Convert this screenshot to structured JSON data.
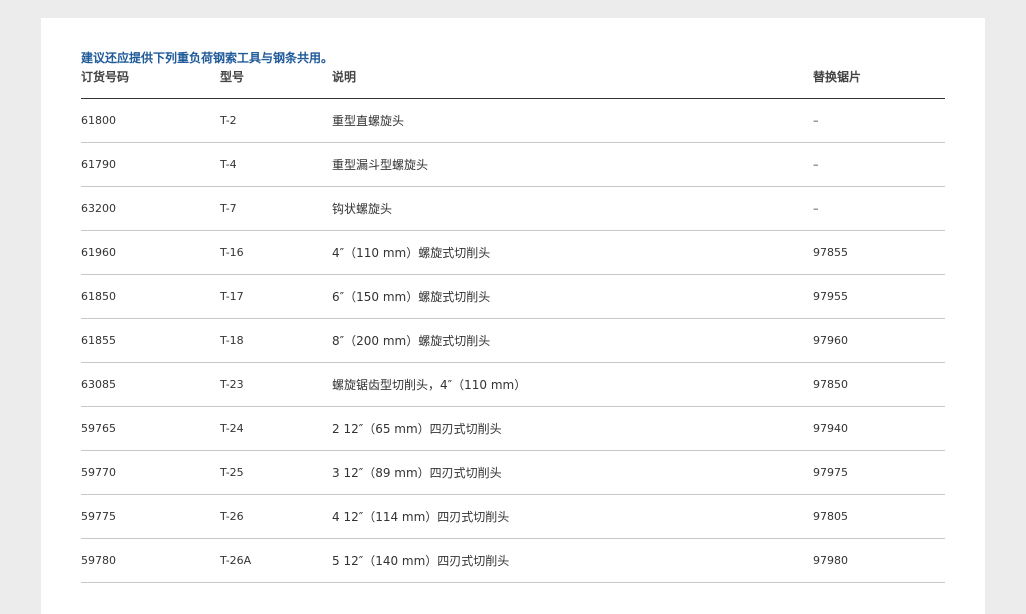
{
  "note": "建议还应提供下列重负荷钢索工具与钢条共用。",
  "table": {
    "headers": [
      "订货号码",
      "型号",
      "说明",
      "替换锯片"
    ],
    "rows": [
      {
        "order_no": "61800",
        "model": "T-2",
        "description": "重型直螺旋头",
        "replacement_blade": "–"
      },
      {
        "order_no": "61790",
        "model": "T-4",
        "description": "重型漏斗型螺旋头",
        "replacement_blade": "–"
      },
      {
        "order_no": "63200",
        "model": "T-7",
        "description": "钩状螺旋头",
        "replacement_blade": "–"
      },
      {
        "order_no": "61960",
        "model": "T-16",
        "description": "4″（110 mm）螺旋式切削头",
        "replacement_blade": "97855"
      },
      {
        "order_no": "61850",
        "model": "T-17",
        "description": "6″（150 mm）螺旋式切削头",
        "replacement_blade": "97955"
      },
      {
        "order_no": "61855",
        "model": "T-18",
        "description": "8″（200 mm）螺旋式切削头",
        "replacement_blade": "97960"
      },
      {
        "order_no": "63085",
        "model": "T-23",
        "description": "螺旋锯齿型切削头，4″（110 mm）",
        "replacement_blade": "97850"
      },
      {
        "order_no": "59765",
        "model": "T-24",
        "description": "2 12″（65 mm）四刃式切削头",
        "replacement_blade": "97940"
      },
      {
        "order_no": "59770",
        "model": "T-25",
        "description": "3 12″（89 mm）四刃式切削头",
        "replacement_blade": "97975"
      },
      {
        "order_no": "59775",
        "model": "T-26",
        "description": "4 12″（114 mm）四刃式切削头",
        "replacement_blade": "97805"
      },
      {
        "order_no": "59780",
        "model": "T-26A",
        "description": "5 12″（140 mm）四刃式切削头",
        "replacement_blade": "97980"
      }
    ]
  }
}
